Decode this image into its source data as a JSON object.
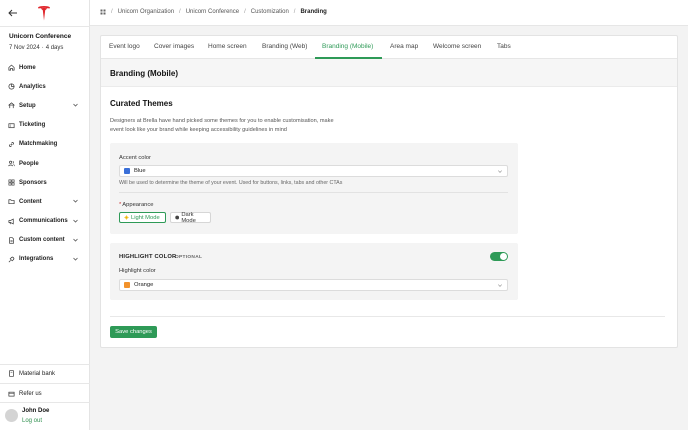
{
  "sidebar": {
    "event_name": "Unicorn Conference",
    "event_date": "7 Nov 2024",
    "event_duration": "4 days",
    "items": [
      {
        "label": "Home",
        "icon": "home-icon",
        "expandable": false
      },
      {
        "label": "Analytics",
        "icon": "analytics-icon",
        "expandable": false
      },
      {
        "label": "Setup",
        "icon": "setup-icon",
        "expandable": true
      },
      {
        "label": "Ticketing",
        "icon": "ticket-icon",
        "expandable": false
      },
      {
        "label": "Matchmaking",
        "icon": "link-icon",
        "expandable": false
      },
      {
        "label": "People",
        "icon": "people-icon",
        "expandable": false
      },
      {
        "label": "Sponsors",
        "icon": "grid-icon",
        "expandable": false
      },
      {
        "label": "Content",
        "icon": "folder-icon",
        "expandable": true
      },
      {
        "label": "Communications",
        "icon": "megaphone-icon",
        "expandable": true
      },
      {
        "label": "Custom content",
        "icon": "document-icon",
        "expandable": true
      },
      {
        "label": "Integrations",
        "icon": "plug-icon",
        "expandable": true
      }
    ],
    "material_bank": "Material bank",
    "refer_us": "Refer us",
    "user_name": "John Doe",
    "logout": "Log out"
  },
  "breadcrumb": [
    "Unicorn Organization",
    "Unicorn Conference",
    "Customization",
    "Branding"
  ],
  "tabs": [
    {
      "label": "Event logo",
      "active": false
    },
    {
      "label": "Cover images",
      "active": false
    },
    {
      "label": "Home screen",
      "active": false
    },
    {
      "label": "Branding (Web)",
      "active": false
    },
    {
      "label": "Branding (Mobile)",
      "active": true
    },
    {
      "label": "Area map",
      "active": false
    },
    {
      "label": "Welcome screen",
      "active": false
    },
    {
      "label": "Tabs",
      "active": false
    }
  ],
  "page": {
    "section_title": "Branding (Mobile)",
    "curated_title": "Curated Themes",
    "curated_desc": "Designers at Brella have hand picked some themes for you to enable customisation, make event look like your brand while keeping accessibility guidelines in mind"
  },
  "accent": {
    "label": "Accent color",
    "value": "Blue",
    "swatch": "#3a6fd8",
    "hint": "Will be used to determine the theme of your event. Used for buttons, links, tabs and other CTAs"
  },
  "appearance": {
    "label": "Appearance",
    "light": "Light Mode",
    "dark": "Dark Mode",
    "selected": "Light Mode"
  },
  "highlight": {
    "title": "HIGHLIGHT COLOR",
    "optional": "OPTIONAL",
    "enabled": true,
    "label": "Highlight color",
    "value": "Orange",
    "swatch": "#f2922b"
  },
  "actions": {
    "save": "Save changes"
  },
  "colors": {
    "accent": "#2e9a57",
    "brand": "#e0262c"
  }
}
